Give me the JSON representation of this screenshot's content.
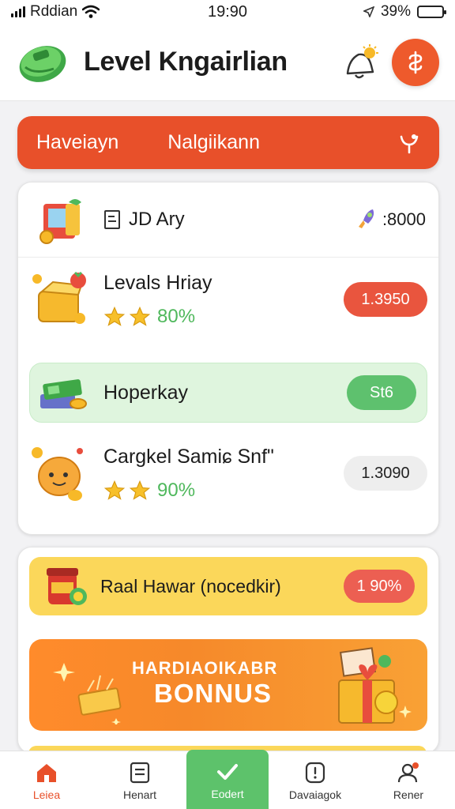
{
  "status_bar": {
    "carrier": "Rddian",
    "time": "19:90",
    "battery": "39%"
  },
  "header": {
    "title": "Level Kngairlian"
  },
  "tabs": [
    {
      "label": "Haveiayn"
    },
    {
      "label": "Nalgiikann"
    }
  ],
  "summary": {
    "label": "JD Ary",
    "total": ":8000"
  },
  "tasks": [
    {
      "title": "Levals Hriay",
      "stars": 2,
      "percent": "80%",
      "value": "1.3950",
      "style": "red"
    },
    {
      "title": "Hoperkay",
      "value": "St6",
      "style": "green"
    },
    {
      "title": "Cargkel Samiɕ Snf\"",
      "stars": 2,
      "percent": "90%",
      "value": "1.3090",
      "style": "gray"
    }
  ],
  "promo": {
    "label": "Raal Hawar (nocedkir)",
    "value": "1 90%"
  },
  "bonus": {
    "line1": "HARDIAOIKABR",
    "line2": "BONNUS"
  },
  "bottom_nav": [
    {
      "label": "Leiea",
      "icon": "home-icon"
    },
    {
      "label": "Henart",
      "icon": "list-icon"
    },
    {
      "label": "Eodert",
      "icon": "check-icon"
    },
    {
      "label": "Davaiagok",
      "icon": "info-icon"
    },
    {
      "label": "Rener",
      "icon": "profile-icon"
    }
  ],
  "colors": {
    "accent": "#e8502a",
    "green": "#5ec16e",
    "yellow": "#fbd75a",
    "orange": "#f6892a"
  }
}
